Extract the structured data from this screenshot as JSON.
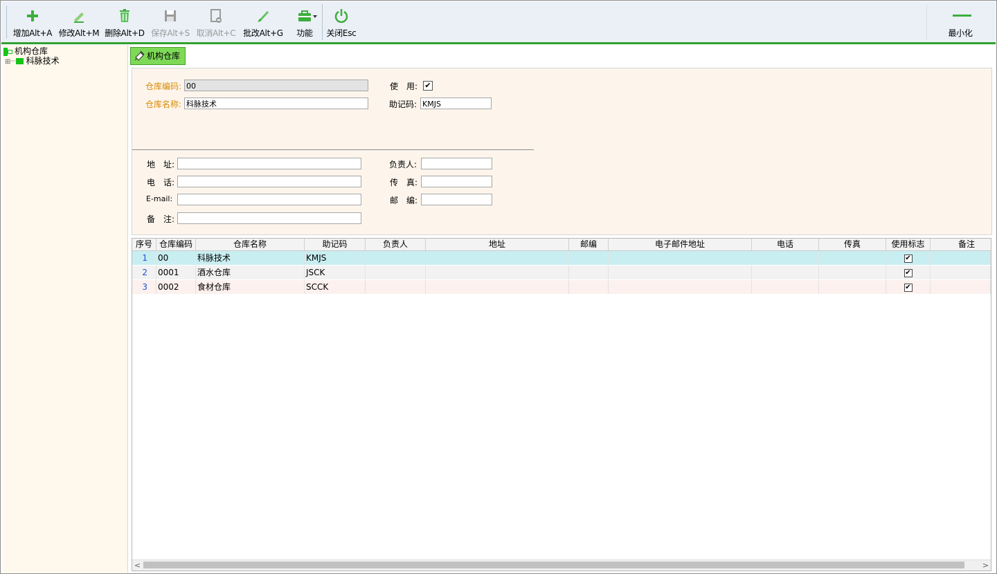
{
  "toolbar": {
    "buttons": [
      {
        "label": "增加Alt+A"
      },
      {
        "label": "修改Alt+M"
      },
      {
        "label": "删除Alt+D"
      },
      {
        "label": "保存Alt+S"
      },
      {
        "label": "取消Alt+C"
      },
      {
        "label": "批改Alt+G"
      },
      {
        "label": "功能"
      },
      {
        "label": "关闭Esc"
      }
    ],
    "minimize_label": "最小化"
  },
  "colors": {
    "accent_green": "#2fa12f",
    "tab_green": "#7ed957",
    "form_bg": "#fdf5ec",
    "row_selected": "#c9eef2",
    "label_orange": "#d98a00"
  },
  "tree": {
    "root_label": "机构仓库",
    "child_label": "科脉技术",
    "expander": "⊞"
  },
  "tab": {
    "label": "机构仓库",
    "icon": "edit-paper-icon"
  },
  "form": {
    "code_label": "仓库编码:",
    "code_value": "00",
    "name_label": "仓库名称:",
    "name_value": "科脉技术",
    "use_label": "使　用:",
    "use_checked": "✔",
    "mnemonic_label": "助记码:",
    "mnemonic_value": "KMJS",
    "address_label": "地　址:",
    "address_value": "",
    "phone_label": "电　话:",
    "phone_value": "",
    "email_label": "E-mail:",
    "email_value": "",
    "remark_label": "备　注:",
    "remark_value": "",
    "manager_label": "负责人:",
    "manager_value": "",
    "fax_label": "传　真:",
    "fax_value": "",
    "postcode_label": "邮　编:",
    "postcode_value": ""
  },
  "grid": {
    "columns": [
      "序号",
      "仓库编码",
      "仓库名称",
      "助记码",
      "负责人",
      "地址",
      "邮编",
      "电子邮件地址",
      "电话",
      "传真",
      "使用标志",
      "备注"
    ],
    "rows": [
      {
        "idx": "1",
        "code": "00",
        "name": "科脉技术",
        "mnemonic": "KMJS",
        "manager": "",
        "address": "",
        "postcode": "",
        "email": "",
        "phone": "",
        "fax": "",
        "used": "✔",
        "remark": ""
      },
      {
        "idx": "2",
        "code": "0001",
        "name": "酒水仓库",
        "mnemonic": "JSCK",
        "manager": "",
        "address": "",
        "postcode": "",
        "email": "",
        "phone": "",
        "fax": "",
        "used": "✔",
        "remark": ""
      },
      {
        "idx": "3",
        "code": "0002",
        "name": "食材仓库",
        "mnemonic": "SCCK",
        "manager": "",
        "address": "",
        "postcode": "",
        "email": "",
        "phone": "",
        "fax": "",
        "used": "✔",
        "remark": ""
      }
    ],
    "scroll_left": "<",
    "scroll_right": ">"
  }
}
